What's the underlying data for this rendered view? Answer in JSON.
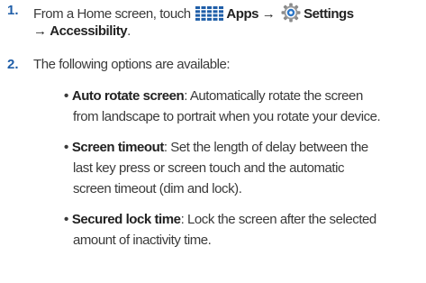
{
  "steps": [
    {
      "number": "1.",
      "prefix": "From a Home screen, touch",
      "apps_label": "Apps",
      "settings_label": "Settings",
      "arrow": "→",
      "accessibility_label": "Accessibility",
      "end": "."
    },
    {
      "number": "2.",
      "text": "The following options are available:"
    }
  ],
  "options": [
    {
      "title": "Auto rotate screen",
      "lines": [
        ": Automatically rotate the screen",
        "from landscape to portrait when you rotate your device."
      ]
    },
    {
      "title": "Screen timeout",
      "lines": [
        ": Set the length of delay between the",
        "last key press or screen touch and the automatic",
        "screen timeout (dim and lock)."
      ]
    },
    {
      "title": "Secured lock time",
      "lines": [
        ": Lock the screen after the selected",
        "amount of inactivity time."
      ]
    }
  ],
  "icons": {
    "apps": "apps-grid-icon",
    "settings": "settings-gear-icon"
  },
  "colors": {
    "accent": "#1f5ea8",
    "text": "#3a3a3a"
  }
}
